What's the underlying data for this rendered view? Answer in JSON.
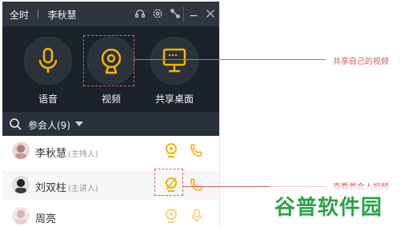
{
  "window": {
    "title_left": "全时",
    "title_name": "李秋慧",
    "controls": [
      "headset-icon",
      "settings-icon",
      "tools-icon",
      "minimize-icon",
      "close-icon"
    ]
  },
  "toolbar": {
    "voice_label": "语音",
    "video_label": "视频",
    "share_label": "共享桌面"
  },
  "participants_filter": {
    "label": "参会人(9)"
  },
  "participants": [
    {
      "name": "李秋慧",
      "role": "(主持人)",
      "video": "on",
      "audio": "phone"
    },
    {
      "name": "刘双柱",
      "role": "(主讲人)",
      "video": "off",
      "audio": "phone"
    },
    {
      "name": "周亮",
      "role": "",
      "video": "muted",
      "audio": "mic"
    }
  ],
  "annotations": {
    "share_video": "共享自己的视频",
    "view_video": "查看参会人视频"
  },
  "colors": {
    "accent": "#f0b400",
    "annotation": "#e25c5c",
    "dark_title": "#2f3640",
    "dark_toolbar": "#1b222a",
    "watermark": "#2ca24a"
  },
  "watermark": {
    "text": "谷普软件园"
  }
}
